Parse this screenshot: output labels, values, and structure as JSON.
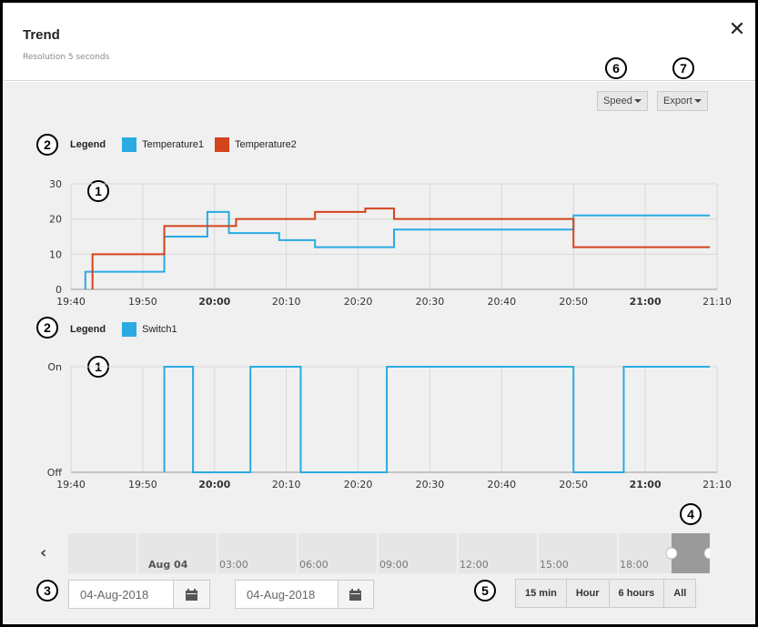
{
  "window": {
    "title": "Trend",
    "subtitle": "Resolution 5 seconds",
    "close_glyph": "✕"
  },
  "callouts": [
    "1",
    "2",
    "3",
    "4",
    "5",
    "6",
    "7"
  ],
  "toolbar": {
    "speed_label": "Speed",
    "export_label": "Export"
  },
  "legend_temp": {
    "title": "Legend",
    "items": [
      {
        "label": "Temperature1",
        "color": "#29abe2"
      },
      {
        "label": "Temperature2",
        "color": "#d4431c"
      }
    ]
  },
  "legend_switch": {
    "title": "Legend",
    "items": [
      {
        "label": "Switch1",
        "color": "#29abe2"
      }
    ]
  },
  "chart_data": [
    {
      "type": "line",
      "step": true,
      "xlim": [
        "19:40",
        "21:10"
      ],
      "x_ticks": [
        "19:40",
        "19:50",
        "20:00",
        "20:10",
        "20:20",
        "20:30",
        "20:40",
        "20:50",
        "21:00",
        "21:10"
      ],
      "bold_ticks": [
        "20:00",
        "21:00"
      ],
      "ylim": [
        0,
        30
      ],
      "y_ticks": [
        0,
        10,
        20,
        30
      ],
      "grid": true,
      "series": [
        {
          "name": "Temperature1",
          "color": "#29abe2",
          "points": [
            [
              "19:42",
              0
            ],
            [
              "19:42",
              5
            ],
            [
              "19:53",
              15
            ],
            [
              "19:59",
              22
            ],
            [
              "20:02",
              16
            ],
            [
              "20:09",
              14
            ],
            [
              "20:14",
              12
            ],
            [
              "20:25",
              17
            ],
            [
              "20:50",
              21
            ],
            [
              "21:09",
              21
            ]
          ]
        },
        {
          "name": "Temperature2",
          "color": "#d4431c",
          "points": [
            [
              "19:43",
              0
            ],
            [
              "19:43",
              10
            ],
            [
              "19:53",
              18
            ],
            [
              "20:03",
              20
            ],
            [
              "20:14",
              22
            ],
            [
              "20:21",
              23
            ],
            [
              "20:25",
              20
            ],
            [
              "20:50",
              12
            ],
            [
              "21:09",
              12
            ]
          ]
        }
      ]
    },
    {
      "type": "line",
      "step": true,
      "xlim": [
        "19:40",
        "21:10"
      ],
      "x_ticks": [
        "19:40",
        "19:50",
        "20:00",
        "20:10",
        "20:20",
        "20:30",
        "20:40",
        "20:50",
        "21:00",
        "21:10"
      ],
      "bold_ticks": [
        "20:00",
        "21:00"
      ],
      "y_categories": [
        "Off",
        "On"
      ],
      "grid": true,
      "series": [
        {
          "name": "Switch1",
          "color": "#29abe2",
          "points": [
            [
              "19:53",
              0
            ],
            [
              "19:53",
              1
            ],
            [
              "19:57",
              0
            ],
            [
              "20:05",
              1
            ],
            [
              "20:12",
              0
            ],
            [
              "20:24",
              1
            ],
            [
              "20:50",
              0
            ],
            [
              "20:57",
              1
            ],
            [
              "21:09",
              1
            ]
          ]
        }
      ]
    }
  ],
  "timeline": {
    "labels": [
      "Aug 04",
      "03:00",
      "06:00",
      "09:00",
      "12:00",
      "15:00",
      "18:00"
    ],
    "bold_labels": [
      "Aug 04"
    ],
    "nav_left_glyph": "‹"
  },
  "date_range": {
    "start": "04-Aug-2018",
    "end": "04-Aug-2018"
  },
  "range_buttons": [
    "15 min",
    "Hour",
    "6 hours",
    "All"
  ]
}
